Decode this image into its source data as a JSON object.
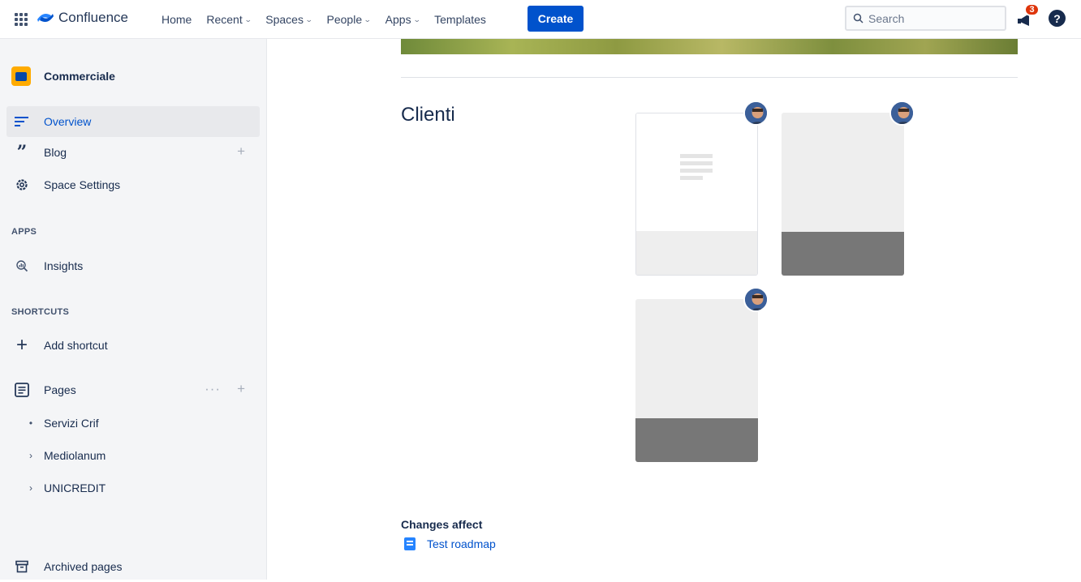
{
  "topbar": {
    "brand": "Confluence",
    "nav": [
      {
        "label": "Home",
        "has_menu": false
      },
      {
        "label": "Recent",
        "has_menu": true
      },
      {
        "label": "Spaces",
        "has_menu": true
      },
      {
        "label": "People",
        "has_menu": true
      },
      {
        "label": "Apps",
        "has_menu": true
      },
      {
        "label": "Templates",
        "has_menu": false
      }
    ],
    "create_label": "Create",
    "search_placeholder": "Search",
    "notification_count": "3",
    "help_glyph": "?"
  },
  "sidebar": {
    "space_name": "Commerciale",
    "items": [
      {
        "label": "Overview",
        "icon": "overview-icon"
      },
      {
        "label": "Blog",
        "icon": "quote-icon"
      },
      {
        "label": "Space Settings",
        "icon": "gear-icon"
      }
    ],
    "apps_heading": "APPS",
    "apps": [
      {
        "label": "Insights",
        "icon": "insights-icon"
      }
    ],
    "shortcuts_heading": "SHORTCUTS",
    "add_shortcut": "Add shortcut",
    "pages_label": "Pages",
    "pages": [
      {
        "label": "Servizi Crif",
        "marker": "•"
      },
      {
        "label": "Mediolanum",
        "marker": "›"
      },
      {
        "label": "UNICREDIT",
        "marker": "›"
      }
    ],
    "archived_label": "Archived pages"
  },
  "main": {
    "section_title": "Clienti",
    "changes_label": "Changes affect",
    "linked_page": "Test roadmap"
  },
  "colors": {
    "primary": "#0052CC",
    "text": "#172B4D",
    "sidebar_bg": "#F4F5F7",
    "badge": "#DE350B"
  }
}
